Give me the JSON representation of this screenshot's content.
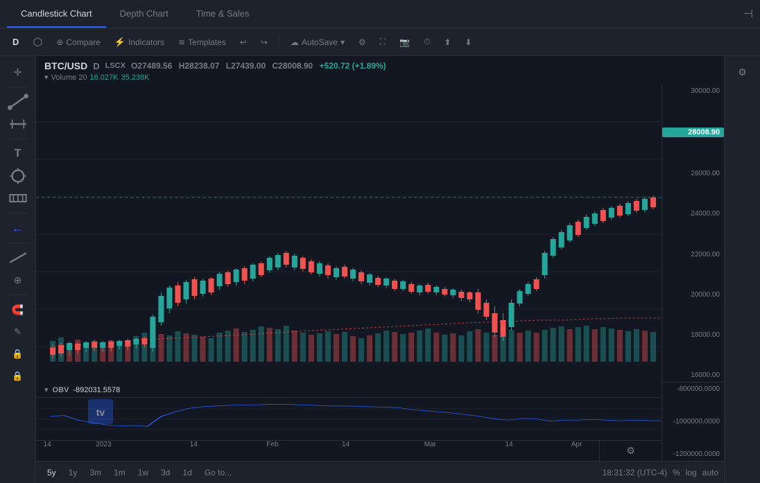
{
  "tabs": {
    "items": [
      {
        "label": "Candlestick Chart",
        "active": true
      },
      {
        "label": "Depth Chart",
        "active": false
      },
      {
        "label": "Time & Sales",
        "active": false
      }
    ]
  },
  "toolbar": {
    "timeframe": "D",
    "indicators_icon": "⚡",
    "indicators_label": "Indicators",
    "templates_label": "Templates",
    "compare_label": "Compare",
    "undo_icon": "↩",
    "redo_icon": "↪",
    "autosave_label": "AutoSave",
    "settings_icon": "⚙",
    "fullscreen_icon": "⛶",
    "camera_icon": "📷",
    "timer_icon": "⏱",
    "upload_icon": "⬆",
    "download_icon": "⬇"
  },
  "chart_info": {
    "symbol": "BTC/USD",
    "timeframe": "D",
    "exchange": "LSCX",
    "open": "O27489.56",
    "high": "H28238.07",
    "low": "L27439.00",
    "close": "C28008.90",
    "change": "+520.72 (+1.89%)",
    "volume_label": "Volume 20",
    "volume_val1": "16.027K",
    "volume_val2": "35.238K"
  },
  "price_axis": {
    "candle": [
      "30000.00",
      "28000.00",
      "26000.00",
      "24000.00",
      "22000.00",
      "20000.00",
      "18000.00",
      "16000.00"
    ],
    "current_price": "28008.90",
    "obv": [
      "-800000.0000",
      "-1000000.0000",
      "-1200000.0000"
    ]
  },
  "obv": {
    "label": "OBV",
    "value": "-892031.5578"
  },
  "time_labels": [
    "14",
    "2023",
    "14",
    "Feb",
    "14",
    "Mar",
    "14",
    "Apr"
  ],
  "bottom_toolbar": {
    "timeframes": [
      "5y",
      "1y",
      "3m",
      "1m",
      "1w",
      "3d",
      "1d"
    ],
    "goto": "Go to...",
    "timestamp": "18:31:32 (UTC-4)",
    "percent": "%",
    "log": "log",
    "auto": "auto"
  },
  "left_tools": [
    "✛",
    "⬡",
    "✂",
    "🔗",
    "T",
    "⚬",
    "⊞",
    "←",
    "✏",
    "⊕",
    "🧲",
    "✎",
    "🔒"
  ],
  "right_tools": [
    "⚙"
  ]
}
